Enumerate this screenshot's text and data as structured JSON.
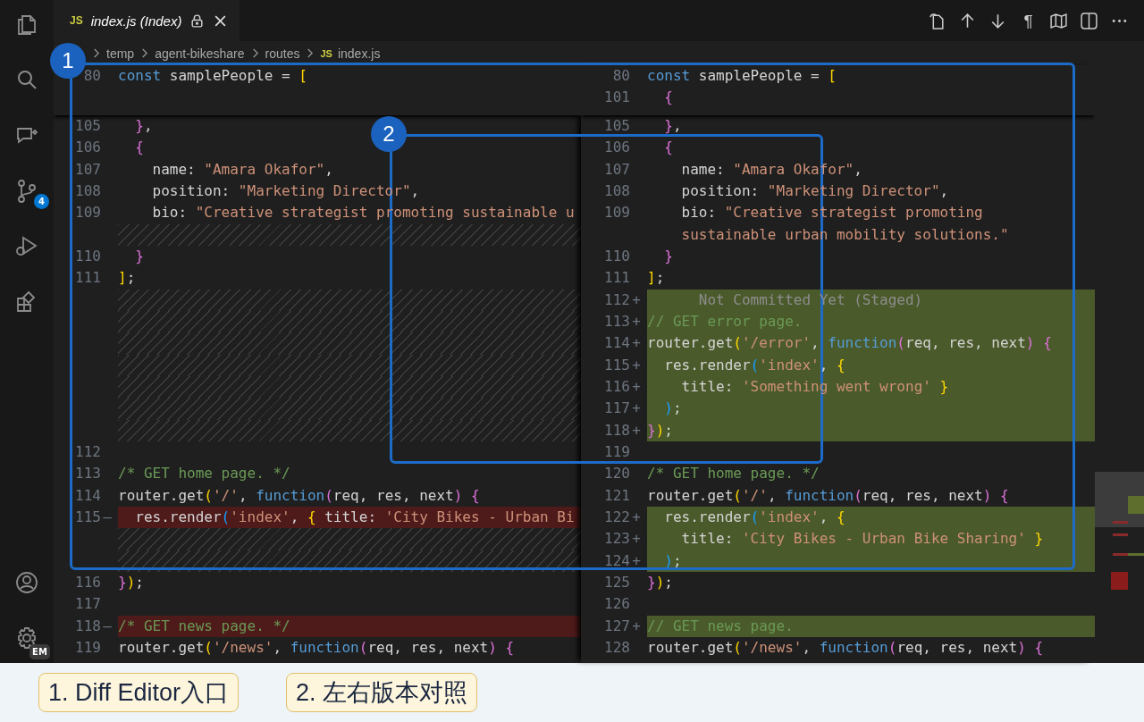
{
  "activity_bar": {
    "source_control_badge": "4",
    "account_badge": "EM"
  },
  "tab": {
    "file_badge": "JS",
    "label": "index.js (Index)"
  },
  "toolbar": {
    "whitespace_glyph": "¶"
  },
  "breadcrumb": {
    "folders": [
      "temp",
      "agent-bikeshare",
      "routes"
    ],
    "file_badge": "JS",
    "file": "index.js"
  },
  "panes": [
    {
      "sticky_rows": [
        {
          "kind": "code",
          "number": "80",
          "added": false,
          "removed": false,
          "tokens": [
            {
              "kind": "keyword",
              "text": "const"
            },
            {
              "kind": "plain",
              "text": " samplePeople = "
            },
            {
              "kind": "bracket1",
              "text": "["
            }
          ]
        }
      ],
      "rows": [
        {
          "kind": "code",
          "number": "105",
          "added": false,
          "removed": false,
          "tokens": [
            {
              "kind": "bracket2",
              "text": "  }"
            },
            {
              "kind": "plain",
              "text": ","
            }
          ]
        },
        {
          "kind": "code",
          "number": "106",
          "added": false,
          "removed": false,
          "tokens": [
            {
              "kind": "bracket2",
              "text": "  {"
            }
          ]
        },
        {
          "kind": "code",
          "number": "107",
          "added": false,
          "removed": false,
          "tokens": [
            {
              "kind": "plain",
              "text": "    name: "
            },
            {
              "kind": "string",
              "text": "\"Amara Okafor\""
            },
            {
              "kind": "plain",
              "text": ","
            }
          ]
        },
        {
          "kind": "code",
          "number": "108",
          "added": false,
          "removed": false,
          "tokens": [
            {
              "kind": "plain",
              "text": "    position: "
            },
            {
              "kind": "string",
              "text": "\"Marketing Director\""
            },
            {
              "kind": "plain",
              "text": ","
            }
          ]
        },
        {
          "kind": "code",
          "number": "109",
          "added": false,
          "removed": false,
          "tokens": [
            {
              "kind": "plain",
              "text": "    bio: "
            },
            {
              "kind": "string",
              "text": "\"Creative strategist promoting sustainable u"
            }
          ]
        },
        {
          "kind": "filler"
        },
        {
          "kind": "code",
          "number": "110",
          "added": false,
          "removed": false,
          "tokens": [
            {
              "kind": "bracket2",
              "text": "  }"
            }
          ]
        },
        {
          "kind": "code",
          "number": "111",
          "added": false,
          "removed": false,
          "tokens": [
            {
              "kind": "bracket1",
              "text": "]"
            },
            {
              "kind": "plain",
              "text": ";"
            }
          ]
        },
        {
          "kind": "filler"
        },
        {
          "kind": "filler"
        },
        {
          "kind": "filler"
        },
        {
          "kind": "filler"
        },
        {
          "kind": "filler"
        },
        {
          "kind": "filler"
        },
        {
          "kind": "filler"
        },
        {
          "kind": "code",
          "number": "112",
          "added": false,
          "removed": false,
          "tokens": []
        },
        {
          "kind": "code",
          "number": "113",
          "added": false,
          "removed": false,
          "tokens": [
            {
              "kind": "comment",
              "text": "/* GET home page. */"
            }
          ]
        },
        {
          "kind": "code",
          "number": "114",
          "added": false,
          "removed": false,
          "tokens": [
            {
              "kind": "plain",
              "text": "router.get"
            },
            {
              "kind": "bracket1",
              "text": "("
            },
            {
              "kind": "string",
              "text": "'/'"
            },
            {
              "kind": "plain",
              "text": ", "
            },
            {
              "kind": "keyword",
              "text": "function"
            },
            {
              "kind": "bracket2",
              "text": "("
            },
            {
              "kind": "plain",
              "text": "req, res, next"
            },
            {
              "kind": "bracket2",
              "text": ")"
            },
            {
              "kind": "bracket2",
              "text": " {"
            }
          ]
        },
        {
          "kind": "code",
          "number": "115",
          "sign": "—",
          "added": false,
          "removed": true,
          "tokens": [
            {
              "kind": "plain",
              "text": "  res.render"
            },
            {
              "kind": "bracket3",
              "text": "("
            },
            {
              "kind": "string",
              "text": "'index'"
            },
            {
              "kind": "plain",
              "text": ", "
            },
            {
              "kind": "bracket1",
              "text": "{"
            },
            {
              "kind": "plain",
              "text": " title: "
            },
            {
              "kind": "string",
              "text": "'City Bikes - Urban Bi"
            }
          ]
        },
        {
          "kind": "filler"
        },
        {
          "kind": "filler"
        },
        {
          "kind": "code",
          "number": "116",
          "added": false,
          "removed": false,
          "tokens": [
            {
              "kind": "bracket2",
              "text": "}"
            },
            {
              "kind": "bracket1",
              "text": ")"
            },
            {
              "kind": "plain",
              "text": ";"
            }
          ]
        },
        {
          "kind": "code",
          "number": "117",
          "added": false,
          "removed": false,
          "tokens": []
        },
        {
          "kind": "code",
          "number": "118",
          "sign": "—",
          "added": false,
          "removed": true,
          "tokens": [
            {
              "kind": "comment",
              "text": "/* GET news page. */"
            }
          ]
        },
        {
          "kind": "code",
          "number": "119",
          "added": false,
          "removed": false,
          "tokens": [
            {
              "kind": "plain",
              "text": "router.get"
            },
            {
              "kind": "bracket1",
              "text": "("
            },
            {
              "kind": "string",
              "text": "'/news'"
            },
            {
              "kind": "plain",
              "text": ", "
            },
            {
              "kind": "keyword",
              "text": "function"
            },
            {
              "kind": "bracket2",
              "text": "("
            },
            {
              "kind": "plain",
              "text": "req, res, next"
            },
            {
              "kind": "bracket2",
              "text": ")"
            },
            {
              "kind": "bracket2",
              "text": " {"
            }
          ]
        }
      ]
    },
    {
      "sticky_rows": [
        {
          "kind": "code",
          "number": "80",
          "added": false,
          "removed": false,
          "tokens": [
            {
              "kind": "keyword",
              "text": "const"
            },
            {
              "kind": "plain",
              "text": " samplePeople = "
            },
            {
              "kind": "bracket1",
              "text": "["
            }
          ]
        },
        {
          "kind": "code",
          "number": "101",
          "added": false,
          "removed": false,
          "tokens": [
            {
              "kind": "bracket2",
              "text": "  {"
            }
          ]
        }
      ],
      "rows": [
        {
          "kind": "code",
          "number": "105",
          "added": false,
          "removed": false,
          "tokens": [
            {
              "kind": "bracket2",
              "text": "  }"
            },
            {
              "kind": "plain",
              "text": ","
            }
          ]
        },
        {
          "kind": "code",
          "number": "106",
          "added": false,
          "removed": false,
          "tokens": [
            {
              "kind": "bracket2",
              "text": "  {"
            }
          ]
        },
        {
          "kind": "code",
          "number": "107",
          "added": false,
          "removed": false,
          "tokens": [
            {
              "kind": "plain",
              "text": "    name: "
            },
            {
              "kind": "string",
              "text": "\"Amara Okafor\""
            },
            {
              "kind": "plain",
              "text": ","
            }
          ]
        },
        {
          "kind": "code",
          "number": "108",
          "added": false,
          "removed": false,
          "tokens": [
            {
              "kind": "plain",
              "text": "    position: "
            },
            {
              "kind": "string",
              "text": "\"Marketing Director\""
            },
            {
              "kind": "plain",
              "text": ","
            }
          ]
        },
        {
          "kind": "code",
          "number": "109",
          "added": false,
          "removed": false,
          "tokens": [
            {
              "kind": "plain",
              "text": "    bio: "
            },
            {
              "kind": "string",
              "text": "\"Creative strategist promoting"
            }
          ]
        },
        {
          "kind": "code",
          "added": false,
          "removed": false,
          "tokens": [
            {
              "kind": "string",
              "text": "    sustainable urban mobility solutions.\""
            }
          ]
        },
        {
          "kind": "code",
          "number": "110",
          "added": false,
          "removed": false,
          "tokens": [
            {
              "kind": "bracket2",
              "text": "  }"
            }
          ]
        },
        {
          "kind": "code",
          "number": "111",
          "added": false,
          "removed": false,
          "tokens": [
            {
              "kind": "bracket1",
              "text": "]"
            },
            {
              "kind": "plain",
              "text": ";"
            }
          ]
        },
        {
          "kind": "code",
          "number": "112",
          "sign": "+",
          "added": true,
          "removed": false,
          "tokens": [
            {
              "kind": "annotation",
              "text": "      Not Committed Yet (Staged)"
            }
          ]
        },
        {
          "kind": "code",
          "number": "113",
          "sign": "+",
          "added": true,
          "removed": false,
          "tokens": [
            {
              "kind": "comment",
              "text": "// GET error page."
            }
          ]
        },
        {
          "kind": "code",
          "number": "114",
          "sign": "+",
          "added": true,
          "removed": false,
          "tokens": [
            {
              "kind": "plain",
              "text": "router.get"
            },
            {
              "kind": "bracket1",
              "text": "("
            },
            {
              "kind": "string",
              "text": "'/error'"
            },
            {
              "kind": "plain",
              "text": ", "
            },
            {
              "kind": "keyword",
              "text": "function"
            },
            {
              "kind": "bracket2",
              "text": "("
            },
            {
              "kind": "plain",
              "text": "req, res, next"
            },
            {
              "kind": "bracket2",
              "text": ")"
            },
            {
              "kind": "bracket2",
              "text": " {"
            }
          ]
        },
        {
          "kind": "code",
          "number": "115",
          "sign": "+",
          "added": true,
          "removed": false,
          "tokens": [
            {
              "kind": "plain",
              "text": "  res.render"
            },
            {
              "kind": "bracket3",
              "text": "("
            },
            {
              "kind": "string",
              "text": "'index'"
            },
            {
              "kind": "plain",
              "text": ", "
            },
            {
              "kind": "bracket1",
              "text": "{"
            }
          ]
        },
        {
          "kind": "code",
          "number": "116",
          "sign": "+",
          "added": true,
          "removed": false,
          "tokens": [
            {
              "kind": "plain",
              "text": "    title: "
            },
            {
              "kind": "string",
              "text": "'Something went wrong'"
            },
            {
              "kind": "bracket1",
              "text": " }"
            }
          ]
        },
        {
          "kind": "code",
          "number": "117",
          "sign": "+",
          "added": true,
          "removed": false,
          "tokens": [
            {
              "kind": "bracket3",
              "text": "  )"
            },
            {
              "kind": "plain",
              "text": ";"
            }
          ]
        },
        {
          "kind": "code",
          "number": "118",
          "sign": "+",
          "added": true,
          "removed": false,
          "tokens": [
            {
              "kind": "bracket2",
              "text": "}"
            },
            {
              "kind": "bracket1",
              "text": ")"
            },
            {
              "kind": "plain",
              "text": ";"
            }
          ]
        },
        {
          "kind": "code",
          "number": "119",
          "added": false,
          "removed": false,
          "tokens": []
        },
        {
          "kind": "code",
          "number": "120",
          "added": false,
          "removed": false,
          "tokens": [
            {
              "kind": "comment",
              "text": "/* GET home page. */"
            }
          ]
        },
        {
          "kind": "code",
          "number": "121",
          "added": false,
          "removed": false,
          "tokens": [
            {
              "kind": "plain",
              "text": "router.get"
            },
            {
              "kind": "bracket1",
              "text": "("
            },
            {
              "kind": "string",
              "text": "'/'"
            },
            {
              "kind": "plain",
              "text": ", "
            },
            {
              "kind": "keyword",
              "text": "function"
            },
            {
              "kind": "bracket2",
              "text": "("
            },
            {
              "kind": "plain",
              "text": "req, res, next"
            },
            {
              "kind": "bracket2",
              "text": ")"
            },
            {
              "kind": "bracket2",
              "text": " {"
            }
          ]
        },
        {
          "kind": "code",
          "number": "122",
          "sign": "+",
          "added": true,
          "removed": false,
          "tokens": [
            {
              "kind": "plain",
              "text": "  res.render"
            },
            {
              "kind": "bracket3",
              "text": "("
            },
            {
              "kind": "string",
              "text": "'index'"
            },
            {
              "kind": "plain",
              "text": ", "
            },
            {
              "kind": "bracket1",
              "text": "{"
            }
          ]
        },
        {
          "kind": "code",
          "number": "123",
          "sign": "+",
          "added": true,
          "removed": false,
          "tokens": [
            {
              "kind": "plain",
              "text": "    title: "
            },
            {
              "kind": "string",
              "text": "'City Bikes - Urban Bike Sharing'"
            },
            {
              "kind": "bracket1",
              "text": " }"
            }
          ]
        },
        {
          "kind": "code",
          "number": "124",
          "sign": "+",
          "added": true,
          "removed": false,
          "tokens": [
            {
              "kind": "bracket3",
              "text": "  )"
            },
            {
              "kind": "plain",
              "text": ";"
            }
          ]
        },
        {
          "kind": "code",
          "number": "125",
          "added": false,
          "removed": false,
          "tokens": [
            {
              "kind": "bracket2",
              "text": "}"
            },
            {
              "kind": "bracket1",
              "text": ")"
            },
            {
              "kind": "plain",
              "text": ";"
            }
          ]
        },
        {
          "kind": "code",
          "number": "126",
          "added": false,
          "removed": false,
          "tokens": []
        },
        {
          "kind": "code",
          "number": "127",
          "sign": "+",
          "added": true,
          "removed": false,
          "tokens": [
            {
              "kind": "comment",
              "text": "// GET news page."
            }
          ]
        },
        {
          "kind": "code",
          "number": "128",
          "added": false,
          "removed": false,
          "tokens": [
            {
              "kind": "plain",
              "text": "router.get"
            },
            {
              "kind": "bracket1",
              "text": "("
            },
            {
              "kind": "string",
              "text": "'/news'"
            },
            {
              "kind": "plain",
              "text": ", "
            },
            {
              "kind": "keyword",
              "text": "function"
            },
            {
              "kind": "bracket2",
              "text": "("
            },
            {
              "kind": "plain",
              "text": "req, res, next"
            },
            {
              "kind": "bracket2",
              "text": ")"
            },
            {
              "kind": "bracket2",
              "text": " {"
            }
          ]
        }
      ]
    }
  ],
  "annotations": [
    {
      "label": "1"
    },
    {
      "label": "2"
    }
  ],
  "captions": [
    "1. Diff Editor入口",
    "2. 左右版本对照"
  ]
}
